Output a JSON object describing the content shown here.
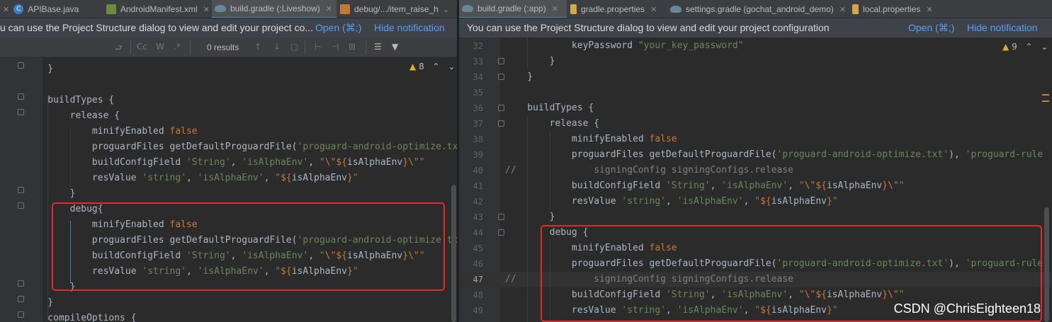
{
  "left": {
    "tabs": [
      {
        "label": "APIBase.java",
        "icon": "class-icon",
        "active": false
      },
      {
        "label": "AndroidManifest.xml",
        "icon": "xml-icon",
        "active": false
      },
      {
        "label": "build.gradle (:Liveshow)",
        "icon": "gradle-icon",
        "active": true
      },
      {
        "label": "debug/.../item_raise_h",
        "icon": "image-icon",
        "active": false
      }
    ],
    "notification": {
      "text": "u can use the Project Structure dialog to view and edit your project co...",
      "open_link": "Open (⌘;)",
      "hide_link": "Hide notification"
    },
    "find_bar": {
      "match_case": "Cc",
      "words": "W",
      "regex": ".*",
      "results": "0 results"
    },
    "inspection": {
      "count": "8"
    },
    "lines": [
      {
        "c": [
          [
            "    }",
            ""
          ]
        ]
      },
      {
        "c": [
          [
            "",
            ""
          ]
        ]
      },
      {
        "c": [
          [
            "    buildTypes {",
            ""
          ]
        ]
      },
      {
        "c": [
          [
            "        release {",
            ""
          ]
        ]
      },
      {
        "c": [
          [
            "            minifyEnabled ",
            ""
          ],
          [
            "false",
            "kw"
          ]
        ]
      },
      {
        "c": [
          [
            "            proguardFiles getDefaultProguardFile(",
            ""
          ],
          [
            "'proguard-android-optimize.txt'",
            "str"
          ]
        ]
      },
      {
        "c": [
          [
            "            buildConfigField ",
            ""
          ],
          [
            "'String'",
            "str"
          ],
          [
            ", ",
            ""
          ],
          [
            "'isAlphaEnv'",
            "str"
          ],
          [
            ", ",
            ""
          ],
          [
            "\"",
            "str"
          ],
          [
            "\\\"",
            "esc"
          ],
          [
            "${",
            "tpl"
          ],
          [
            "isAlphaEnv",
            ""
          ],
          [
            "}",
            "tpl"
          ],
          [
            "\\\"",
            "esc"
          ],
          [
            "\"",
            "str"
          ]
        ]
      },
      {
        "c": [
          [
            "            resValue ",
            ""
          ],
          [
            "'string'",
            "str"
          ],
          [
            ", ",
            ""
          ],
          [
            "'isAlphaEnv'",
            "str"
          ],
          [
            ", ",
            ""
          ],
          [
            "\"",
            "str"
          ],
          [
            "${",
            "tpl"
          ],
          [
            "isAlphaEnv",
            ""
          ],
          [
            "}",
            "tpl"
          ],
          [
            "\"",
            "str"
          ]
        ]
      },
      {
        "c": [
          [
            "        }",
            ""
          ]
        ]
      },
      {
        "c": [
          [
            "        debug{",
            ""
          ]
        ]
      },
      {
        "c": [
          [
            "            minifyEnabled ",
            ""
          ],
          [
            "false",
            "kw"
          ]
        ]
      },
      {
        "c": [
          [
            "            proguardFiles getDefaultProguardFile(",
            ""
          ],
          [
            "'proguard-android-optimize.txt'",
            "str"
          ]
        ]
      },
      {
        "c": [
          [
            "            buildConfigField ",
            ""
          ],
          [
            "'String'",
            "str"
          ],
          [
            ", ",
            ""
          ],
          [
            "'isAlphaEnv'",
            "str"
          ],
          [
            ", ",
            ""
          ],
          [
            "\"",
            "str"
          ],
          [
            "\\\"",
            "esc"
          ],
          [
            "${",
            "tpl"
          ],
          [
            "isAlphaEnv",
            ""
          ],
          [
            "}",
            "tpl"
          ],
          [
            "\\\"",
            "esc"
          ],
          [
            "\"",
            "str"
          ]
        ]
      },
      {
        "c": [
          [
            "            resValue ",
            ""
          ],
          [
            "'string'",
            "str"
          ],
          [
            ", ",
            ""
          ],
          [
            "'isAlphaEnv'",
            "str"
          ],
          [
            ", ",
            ""
          ],
          [
            "\"",
            "str"
          ],
          [
            "${",
            "tpl"
          ],
          [
            "isAlphaEnv",
            ""
          ],
          [
            "}",
            "tpl"
          ],
          [
            "\"",
            "str"
          ]
        ]
      },
      {
        "c": [
          [
            "        }",
            ""
          ]
        ]
      },
      {
        "c": [
          [
            "    }",
            ""
          ]
        ]
      },
      {
        "c": [
          [
            "    compileOptions {",
            ""
          ]
        ]
      }
    ]
  },
  "right": {
    "tabs": [
      {
        "label": "build.gradle (:app)",
        "icon": "gradle-icon",
        "active": true
      },
      {
        "label": "gradle.properties",
        "icon": "properties-icon",
        "active": false
      },
      {
        "label": "settings.gradle (gochat_android_demo)",
        "icon": "gradle-icon",
        "active": false
      },
      {
        "label": "local.properties",
        "icon": "properties-icon",
        "active": false
      }
    ],
    "notification": {
      "text": "You can use the Project Structure dialog to view and edit your project configuration",
      "open_link": "Open (⌘;)",
      "hide_link": "Hide notification"
    },
    "inspection": {
      "count": "9"
    },
    "lines": [
      {
        "n": "32",
        "c": [
          [
            "            keyPassword ",
            ""
          ],
          [
            "\"your_key_password\"",
            "str"
          ]
        ]
      },
      {
        "n": "33",
        "c": [
          [
            "        }",
            ""
          ]
        ]
      },
      {
        "n": "34",
        "c": [
          [
            "    }",
            ""
          ]
        ]
      },
      {
        "n": "35",
        "c": [
          [
            "",
            ""
          ]
        ]
      },
      {
        "n": "36",
        "c": [
          [
            "    buildTypes {",
            ""
          ]
        ]
      },
      {
        "n": "37",
        "c": [
          [
            "        release {",
            ""
          ]
        ]
      },
      {
        "n": "38",
        "c": [
          [
            "            minifyEnabled ",
            ""
          ],
          [
            "false",
            "kw"
          ]
        ]
      },
      {
        "n": "39",
        "c": [
          [
            "            proguardFiles getDefaultProguardFile(",
            ""
          ],
          [
            "'proguard-android-optimize.txt'",
            "str"
          ],
          [
            "), ",
            ""
          ],
          [
            "'proguard-rule",
            "str"
          ]
        ]
      },
      {
        "n": "40",
        "c": [
          [
            "//",
            "cmt"
          ],
          [
            "              signingConfig signingConfigs.release",
            "cmt"
          ]
        ]
      },
      {
        "n": "41",
        "c": [
          [
            "            buildConfigField ",
            ""
          ],
          [
            "'String'",
            "str"
          ],
          [
            ", ",
            ""
          ],
          [
            "'isAlphaEnv'",
            "str"
          ],
          [
            ", ",
            ""
          ],
          [
            "\"",
            "str"
          ],
          [
            "\\\"",
            "esc"
          ],
          [
            "${",
            "tpl"
          ],
          [
            "isAlphaEnv",
            ""
          ],
          [
            "}",
            "tpl"
          ],
          [
            "\\\"",
            "esc"
          ],
          [
            "\"",
            "str"
          ]
        ]
      },
      {
        "n": "42",
        "c": [
          [
            "            resValue ",
            ""
          ],
          [
            "'string'",
            "str"
          ],
          [
            ", ",
            ""
          ],
          [
            "'isAlphaEnv'",
            "str"
          ],
          [
            ", ",
            ""
          ],
          [
            "\"",
            "str"
          ],
          [
            "${",
            "tpl"
          ],
          [
            "isAlphaEnv",
            ""
          ],
          [
            "}",
            "tpl"
          ],
          [
            "\"",
            "str"
          ]
        ]
      },
      {
        "n": "43",
        "c": [
          [
            "        }",
            ""
          ]
        ]
      },
      {
        "n": "44",
        "c": [
          [
            "        debug {",
            ""
          ]
        ]
      },
      {
        "n": "45",
        "c": [
          [
            "            minifyEnabled ",
            ""
          ],
          [
            "false",
            "kw"
          ]
        ]
      },
      {
        "n": "46",
        "c": [
          [
            "            proguardFiles getDefaultProguardFile(",
            ""
          ],
          [
            "'proguard-android-optimize.txt'",
            "str"
          ],
          [
            "), ",
            ""
          ],
          [
            "'proguard-rule",
            "str"
          ]
        ]
      },
      {
        "n": "47",
        "c": [
          [
            "//",
            "cmt"
          ],
          [
            "              signingConfig signingConfigs.release",
            "cmt"
          ]
        ]
      },
      {
        "n": "48",
        "c": [
          [
            "            buildConfigField ",
            ""
          ],
          [
            "'String'",
            "str"
          ],
          [
            ", ",
            ""
          ],
          [
            "'isAlphaEnv'",
            "str"
          ],
          [
            ", ",
            ""
          ],
          [
            "\"",
            "str"
          ],
          [
            "\\\"",
            "esc"
          ],
          [
            "${",
            "tpl"
          ],
          [
            "isAlphaEnv",
            ""
          ],
          [
            "}",
            "tpl"
          ],
          [
            "\\\"",
            "esc"
          ],
          [
            "\"",
            "str"
          ]
        ]
      },
      {
        "n": "49",
        "c": [
          [
            "            resValue ",
            ""
          ],
          [
            "'string'",
            "str"
          ],
          [
            ", ",
            ""
          ],
          [
            "'isAlphaEnv'",
            "str"
          ],
          [
            ", ",
            ""
          ],
          [
            "\"",
            "str"
          ],
          [
            "${",
            "tpl"
          ],
          [
            "isAlphaEnv",
            ""
          ],
          [
            "}",
            "tpl"
          ],
          [
            "\"",
            "str"
          ]
        ]
      }
    ]
  },
  "watermark": "CSDN @ChrisEighteen18",
  "colors": {
    "background": "#2b2b2b",
    "keyword": "#cc7832",
    "string": "#6a8759",
    "comment": "#808080",
    "text": "#a9b7c6",
    "highlight_box": "#e32b2b",
    "link": "#589df6"
  }
}
